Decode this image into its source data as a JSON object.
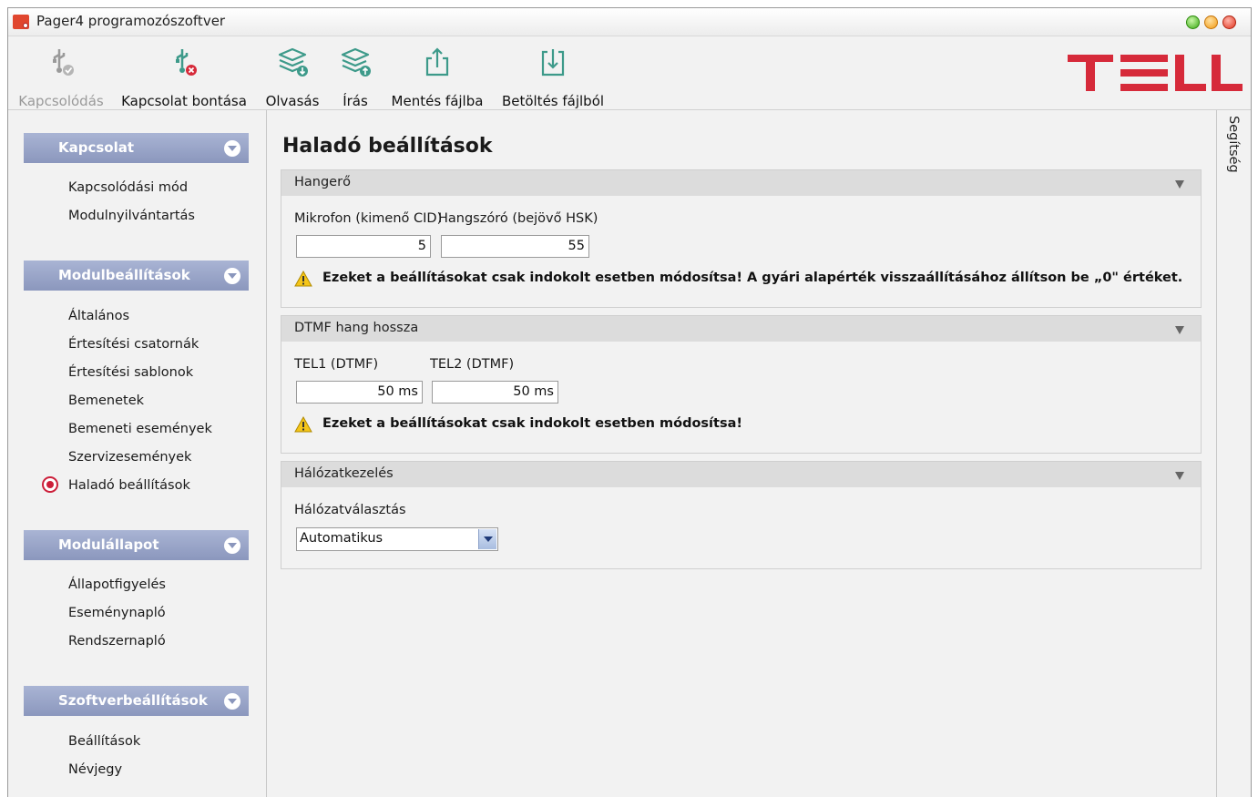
{
  "window": {
    "title": "Pager4 programozószoftver"
  },
  "toolbar": {
    "connect_label": "Kapcsolódás",
    "disconnect_label": "Kapcsolat bontása",
    "read_label": "Olvasás",
    "write_label": "Írás",
    "save_label": "Mentés fájlba",
    "load_label": "Betöltés fájlból"
  },
  "logo": {
    "text": "TELL",
    "color": "#d62a3a"
  },
  "sidebar": {
    "sections": [
      {
        "label": "Kapcsolat",
        "items": [
          "Kapcsolódási mód",
          "Modulnyilvántartás"
        ]
      },
      {
        "label": "Modulbeállítások",
        "items": [
          "Általános",
          "Értesítési csatornák",
          "Értesítési sablonok",
          "Bemenetek",
          "Bemeneti események",
          "Szervizesemények",
          "Haladó beállítások"
        ]
      },
      {
        "label": "Modulállapot",
        "items": [
          "Állapotfigyelés",
          "Eseménynapló",
          "Rendszernapló"
        ]
      },
      {
        "label": "Szoftverbeállítások",
        "items": [
          "Beállítások",
          "Névjegy"
        ]
      }
    ],
    "selected_item": "Haladó beállítások"
  },
  "main": {
    "title": "Haladó beállítások",
    "volume": {
      "title": "Hangerő",
      "mic_label": "Mikrofon (kimenő CID)",
      "mic_value": "5",
      "speaker_label": "Hangszóró (bejövő HSK)",
      "speaker_value": "55",
      "warning": "Ezeket a beállításokat csak indokolt esetben módosítsa! A gyári alapérték visszaállításához állítson be „0\" értéket."
    },
    "dtmf": {
      "title": "DTMF hang hossza",
      "tel1_label": "TEL1 (DTMF)",
      "tel1_value": "50 ms",
      "tel2_label": "TEL2 (DTMF)",
      "tel2_value": "50 ms",
      "warning": "Ezeket a beállításokat csak indokolt esetben módosítsa!"
    },
    "network": {
      "title": "Hálózatkezelés",
      "select_label": "Hálózatválasztás",
      "select_value": "Automatikus"
    }
  },
  "help": {
    "label": "Segítség"
  },
  "colors": {
    "accent": "#d62a3a",
    "section_header": "#97a3c7",
    "toolbar_icon": "#3d9a8a"
  }
}
